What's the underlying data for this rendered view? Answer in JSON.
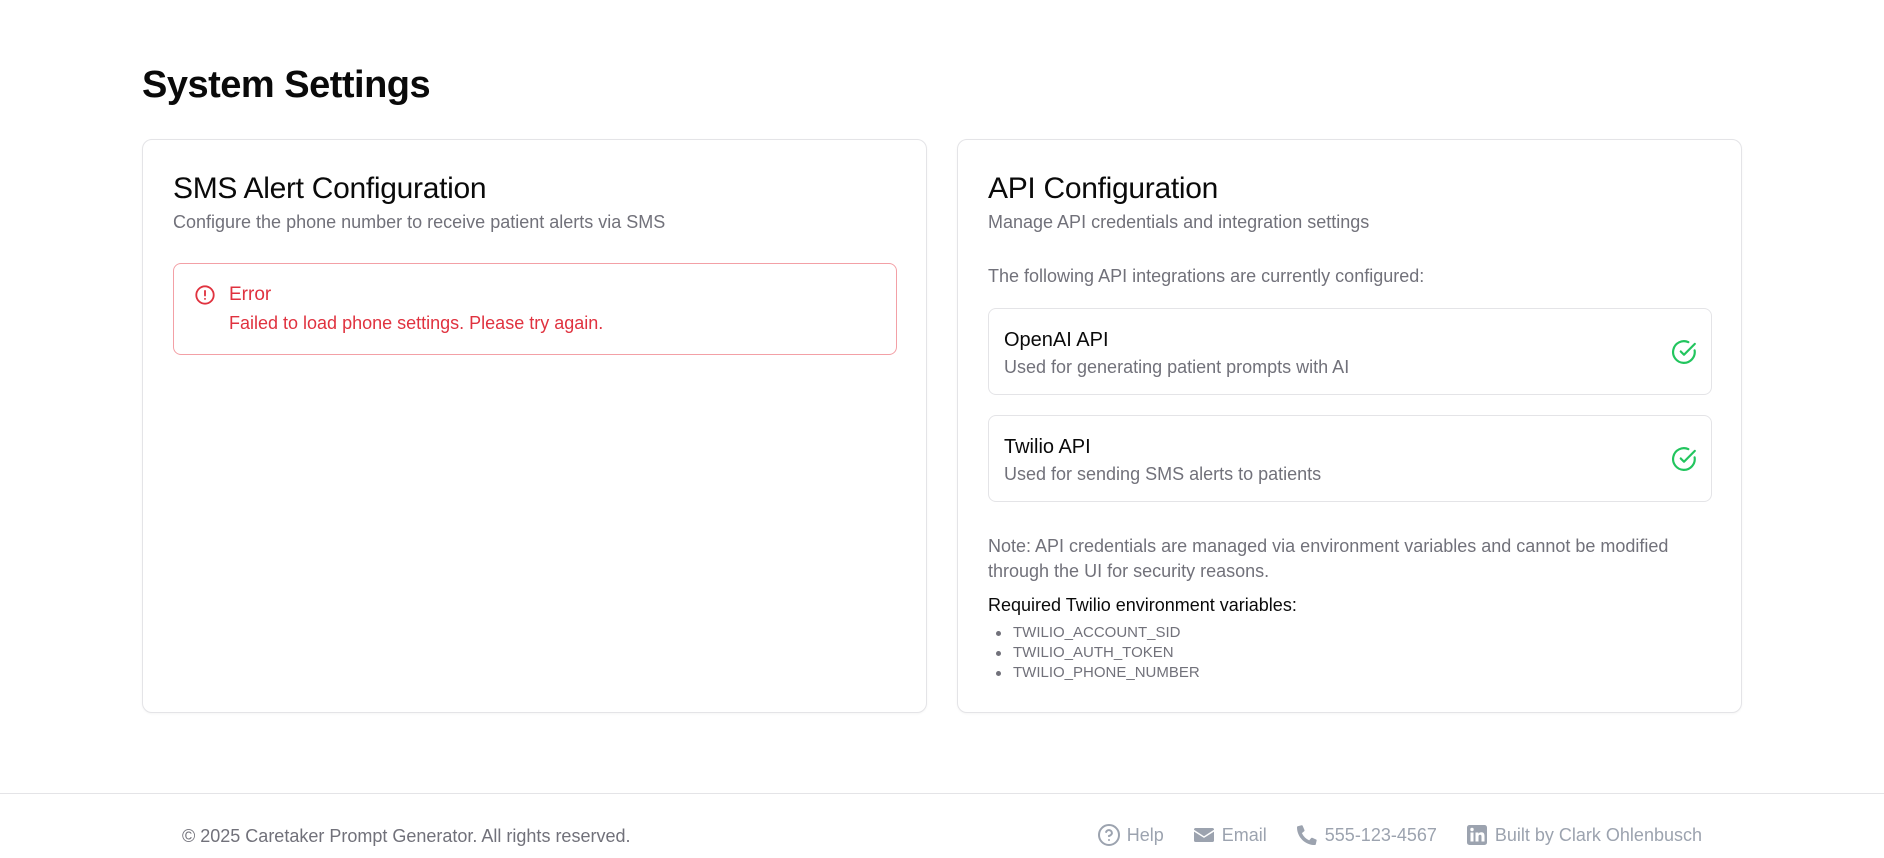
{
  "page": {
    "title": "System Settings"
  },
  "sms_card": {
    "title": "SMS Alert Configuration",
    "description": "Configure the phone number to receive patient alerts via SMS",
    "alert": {
      "icon": "alert-circle-icon",
      "title": "Error",
      "message": "Failed to load phone settings. Please try again."
    }
  },
  "api_card": {
    "title": "API Configuration",
    "description": "Manage API credentials and integration settings",
    "intro": "The following API integrations are currently configured:",
    "integrations": [
      {
        "name": "OpenAI API",
        "description": "Used for generating patient prompts with AI",
        "status_icon": "check-circle-icon"
      },
      {
        "name": "Twilio API",
        "description": "Used for sending SMS alerts to patients",
        "status_icon": "check-circle-icon"
      }
    ],
    "note": "Note: API credentials are managed via environment variables and cannot be modified through the UI for security reasons.",
    "required_title": "Required Twilio environment variables:",
    "env_vars": [
      "TWILIO_ACCOUNT_SID",
      "TWILIO_AUTH_TOKEN",
      "TWILIO_PHONE_NUMBER"
    ]
  },
  "footer": {
    "copyright": "© 2025 Caretaker Prompt Generator. All rights reserved.",
    "links": [
      {
        "label": "Help",
        "icon": "help-circle-icon"
      },
      {
        "label": "Email",
        "icon": "envelope-icon"
      },
      {
        "label": "555-123-4567",
        "icon": "phone-icon"
      },
      {
        "label": "Built by Clark Ohlenbusch",
        "icon": "linkedin-icon"
      }
    ]
  },
  "colors": {
    "error": "#e0323f",
    "error_border": "#f3a0a6",
    "success": "#22c55e",
    "muted_text": "#71717a",
    "footer_icon": "#9ca3af",
    "border": "#e4e4e7"
  }
}
